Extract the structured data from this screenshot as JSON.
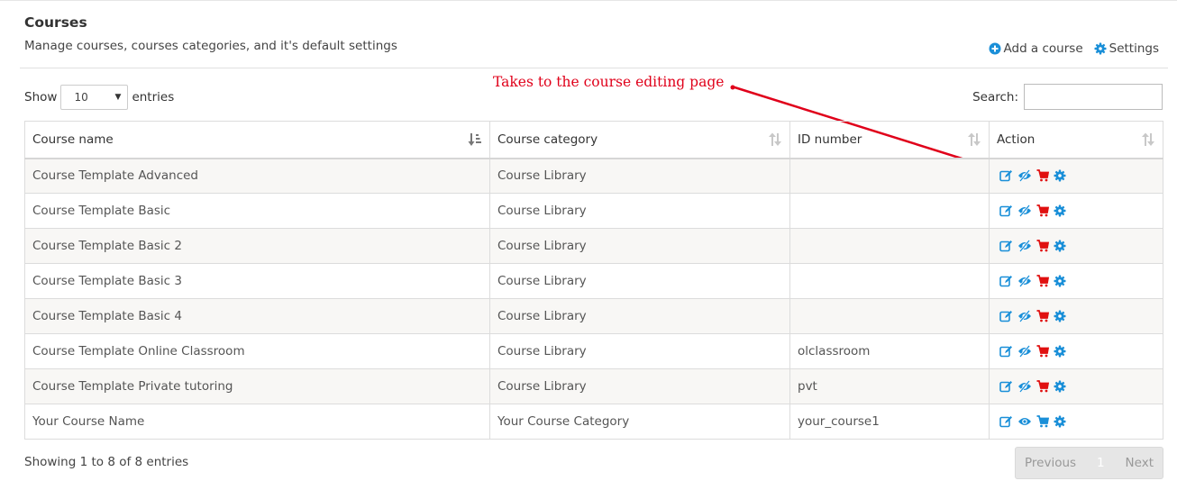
{
  "header": {
    "title": "Courses",
    "subtitle": "Manage courses, courses categories, and it's default settings",
    "add_course_label": "Add a course",
    "settings_label": "Settings"
  },
  "controls": {
    "show_label": "Show",
    "page_size": "10",
    "entries_label": "entries",
    "search_label": "Search:",
    "search_value": ""
  },
  "annotation": {
    "text": "Takes to the course editing page",
    "color": "#e0001a"
  },
  "table": {
    "columns": [
      "Course name",
      "Course category",
      "ID number",
      "Action"
    ],
    "rows": [
      {
        "name": "Course Template Advanced",
        "category": "Course Library",
        "idnumber": "",
        "visibility": "hidden",
        "shop": "red"
      },
      {
        "name": "Course Template Basic",
        "category": "Course Library",
        "idnumber": "",
        "visibility": "hidden",
        "shop": "red"
      },
      {
        "name": "Course Template Basic 2",
        "category": "Course Library",
        "idnumber": "",
        "visibility": "hidden",
        "shop": "red"
      },
      {
        "name": "Course Template Basic 3",
        "category": "Course Library",
        "idnumber": "",
        "visibility": "hidden",
        "shop": "red"
      },
      {
        "name": "Course Template Basic 4",
        "category": "Course Library",
        "idnumber": "",
        "visibility": "hidden",
        "shop": "red"
      },
      {
        "name": "Course Template Online Classroom",
        "category": "Course Library",
        "idnumber": "olclassroom",
        "visibility": "hidden",
        "shop": "red"
      },
      {
        "name": "Course Template Private tutoring",
        "category": "Course Library",
        "idnumber": "pvt",
        "visibility": "hidden",
        "shop": "red"
      },
      {
        "name": "Your Course Name",
        "category": "Your Course Category",
        "idnumber": "your_course1",
        "visibility": "visible",
        "shop": "blue"
      }
    ]
  },
  "footer": {
    "info": "Showing 1 to 8 of 8 entries",
    "previous_label": "Previous",
    "current_page": "1",
    "next_label": "Next"
  },
  "colors": {
    "icon_blue": "#1a8fd8",
    "icon_red": "#e01010",
    "link_text": "#4a6178"
  }
}
